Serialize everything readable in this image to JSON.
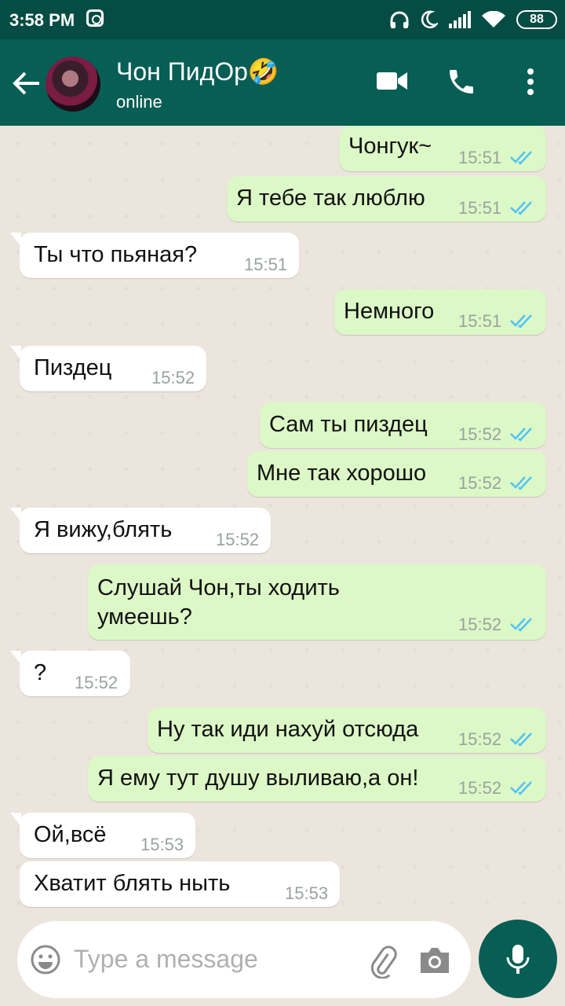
{
  "statusbar": {
    "time": "3:58 PM",
    "battery": "88"
  },
  "header": {
    "contact_name": "Чон ПидОр🤣",
    "contact_status": "online"
  },
  "composer": {
    "placeholder": "Type a message"
  },
  "messages": [
    {
      "dir": "out",
      "text": "Чонгук~",
      "time": "15:51",
      "read": true
    },
    {
      "dir": "out",
      "text": "Я тебе так люблю",
      "time": "15:51",
      "read": true
    },
    {
      "dir": "in",
      "text": "Ты что пьяная?",
      "time": "15:51"
    },
    {
      "dir": "out",
      "text": "Немного",
      "time": "15:51",
      "read": true
    },
    {
      "dir": "in",
      "text": "Пиздец",
      "time": "15:52"
    },
    {
      "dir": "out",
      "text": "Сам ты пиздец",
      "time": "15:52",
      "read": true
    },
    {
      "dir": "out",
      "text": "Мне так хорошо",
      "time": "15:52",
      "read": true
    },
    {
      "dir": "in",
      "text": "Я вижу,блять",
      "time": "15:52"
    },
    {
      "dir": "out",
      "text": "Слушай Чон,ты ходить умеешь?",
      "time": "15:52",
      "read": true
    },
    {
      "dir": "in",
      "text": "?",
      "time": "15:52"
    },
    {
      "dir": "out",
      "text": "Ну так иди нахуй отсюда",
      "time": "15:52",
      "read": true
    },
    {
      "dir": "out",
      "text": "Я ему тут душу выливаю,а он!",
      "time": "15:52",
      "read": true
    },
    {
      "dir": "in",
      "text": "Ой,всё",
      "time": "15:53"
    },
    {
      "dir": "in",
      "text": "Хватит блять ныть",
      "time": "15:53"
    }
  ],
  "colors": {
    "header": "#075e54",
    "statusbar": "#054d44",
    "outgoing": "#dcf8c6",
    "incoming": "#ffffff",
    "read_tick": "#4fc3f7"
  }
}
